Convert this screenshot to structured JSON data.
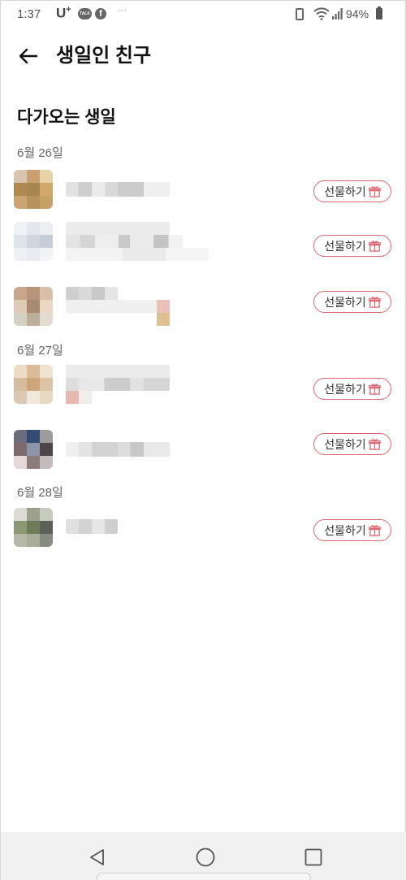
{
  "status_bar": {
    "time": "1:37",
    "carrier": "U",
    "carrier_sup": "+",
    "talk_icon_label": "TALK",
    "facebook_icon_label": "f",
    "more_dots": "···",
    "battery": "94%",
    "icons": [
      "kakaotalk-icon",
      "facebook-icon",
      "vibrate-icon",
      "wifi-icon",
      "signal-icon",
      "battery-icon"
    ]
  },
  "header": {
    "title": "생일인 친구",
    "back_icon": "back-arrow-icon"
  },
  "section": {
    "title": "다가오는 생일"
  },
  "groups": [
    {
      "date": "6월 26일",
      "friends": [
        {
          "gift_label": "선물하기",
          "name_blurred": true,
          "has_status": false
        },
        {
          "gift_label": "선물하기",
          "name_blurred": true,
          "has_status": true
        },
        {
          "gift_label": "선물하기",
          "name_blurred": true,
          "has_status": true
        }
      ]
    },
    {
      "date": "6월 27일",
      "friends": [
        {
          "gift_label": "선물하기",
          "name_blurred": true,
          "has_status": true
        },
        {
          "gift_label": "선물하기",
          "name_blurred": true,
          "has_status": false
        }
      ]
    },
    {
      "date": "6월 28일",
      "friends": [
        {
          "gift_label": "선물하기",
          "name_blurred": true,
          "has_status": false
        }
      ]
    }
  ],
  "gift_icon": "gift-box-icon",
  "nav": {
    "back": "nav-back-icon",
    "home": "nav-home-icon",
    "recents": "nav-recents-icon"
  },
  "colors": {
    "gift_border": "#e06672",
    "gift_icon": "#e06672",
    "nav_background": "#f1f1f1"
  }
}
